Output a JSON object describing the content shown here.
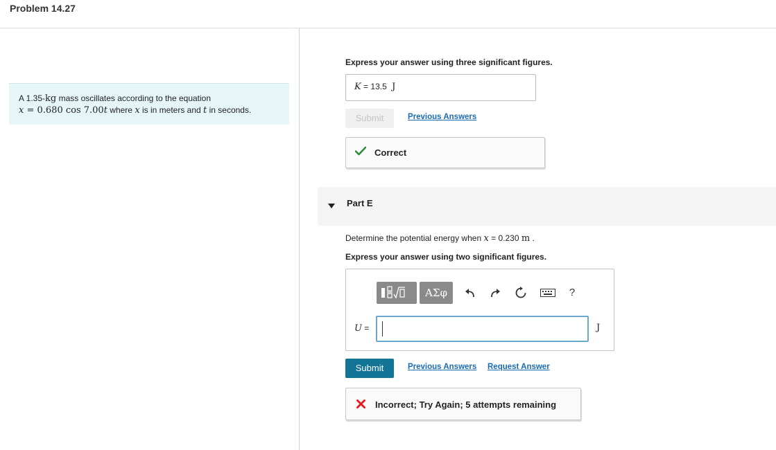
{
  "page_title": "Problem 14.27",
  "problem": {
    "line1_a": "A 1.35-",
    "line1_unit": "kg",
    "line1_b": " mass oscillates according to the equation",
    "x_var": "x",
    "eq_a": " = 0.680  cos  7.00",
    "t_var": "t",
    "where": " where ",
    "where2": " is in meters and ",
    "in_seconds": " in seconds."
  },
  "part_d": {
    "instruction": "Express your answer using three significant figures.",
    "answer_var": "K",
    "answer_eq": " = ",
    "answer_value": "13.5",
    "answer_unit": "J",
    "submit_label": "Submit",
    "previous_answers_label": "Previous Answers",
    "feedback_icon": "check-icon",
    "feedback_text": "Correct",
    "feedback_color": "#2e8b3a"
  },
  "part_e": {
    "title": "Part E",
    "question_a": "Determine the potential energy when ",
    "question_var": "x",
    "question_eq": " = 0.230 ",
    "question_unit": "m",
    "question_end": " .",
    "instruction": "Express your answer using two significant figures.",
    "toolbar": {
      "templates_icon": "fraction-sqrt-templates-icon",
      "symbols_label": "ΑΣφ",
      "undo_icon": "undo-icon",
      "redo_icon": "redo-icon",
      "reset_icon": "reset-icon",
      "keyboard_icon": "keyboard-icon",
      "help_label": "?"
    },
    "input_var": "U",
    "input_eq": " = ",
    "input_value": "",
    "unit": "J",
    "submit_label": "Submit",
    "submit_color": "#137596",
    "previous_answers_label": "Previous Answers",
    "request_answer_label": "Request Answer",
    "feedback_icon": "x-icon",
    "feedback_text": "Incorrect; Try Again; 5 attempts remaining",
    "feedback_color": "#e02020"
  }
}
